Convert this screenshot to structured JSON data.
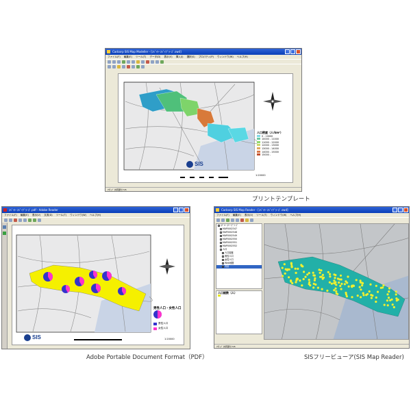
{
  "captions": {
    "print_template": "プリントテンプレート",
    "pdf": "Adobe Portable Document Format（PDF）",
    "viewer": "SISフリービューア(SIS Map Reader)"
  },
  "main_window": {
    "title": "Cadcorp SIS Map Modeller - [ｽﾍﾟｲﾄ･ｽﾍﾟｲﾌﾞﾗ･ｽﾞ.swd]",
    "menus": [
      "ファイル(F)",
      "編集(E)",
      "ツール(T)",
      "データ(D)",
      "表示(V)",
      "挿入(I)",
      "選択(S)",
      "プロパティ(P)",
      "ウィンドウ(W)",
      "ヘルプ(H)"
    ],
    "legend_title": "人口密度（人/km²）",
    "legend_items": [
      "0 - 10000",
      "10000 - 11000",
      "11000 - 12000",
      "12000 - 13000",
      "13000 - 14000",
      "14000 - 15000",
      "15000 -"
    ],
    "legend_colors": [
      "#7fd8e8",
      "#6cc9a2",
      "#8fd86e",
      "#c8d86a",
      "#e0a860",
      "#d87848",
      "#c05030"
    ],
    "logo": "SIS",
    "scale_text": "1:20000",
    "statusbar": "ｱｸﾃｨﾌﾞ 共有部分 SIS"
  },
  "pdf_window": {
    "title": "ｽﾍﾟｲﾄ･ｽﾍﾟｲﾌﾞﾗ･ｽﾞ.pdf - Adobe Reader",
    "menus": [
      "ファイル(F)",
      "編集(E)",
      "表示(V)",
      "文書(D)",
      "ツール(T)",
      "ウィンドウ(W)",
      "ヘルプ(H)"
    ],
    "legend_title": "男性人口・女性人口",
    "legend_items": [
      "男性人口",
      "女性人口"
    ],
    "legend_colors": [
      "#3333cc",
      "#ff33cc"
    ],
    "logo": "SIS",
    "scale_text": "1:20000"
  },
  "viewer_window": {
    "title": "Cadcorp SIS Map Reader - [ｽﾍﾟｲﾄ･ｽﾍﾟｲﾌﾞﾗ･ｽﾞ.swd]",
    "menus": [
      "ファイル(F)",
      "編集(E)",
      "表示(V)",
      "ツール(T)",
      "ウィンドウ(W)",
      "ヘルプ(H)"
    ],
    "tree_items": [
      "ｽﾍﾟｲﾄ･ｽﾍﾟｲﾌﾞﾗ･ｽﾞ",
      "MAP0002347",
      "MAP0002548",
      "MAP0002549",
      "MAP0002550",
      "MAP0002551",
      "MAP0002552",
      "人口",
      "人口密度",
      "男性人口",
      "女性人口",
      "Web地図",
      "背景"
    ],
    "legend_title": "人口総数（人）",
    "statusbar": "ｱｸﾃｨﾌﾞ 共有部分 SIS"
  }
}
